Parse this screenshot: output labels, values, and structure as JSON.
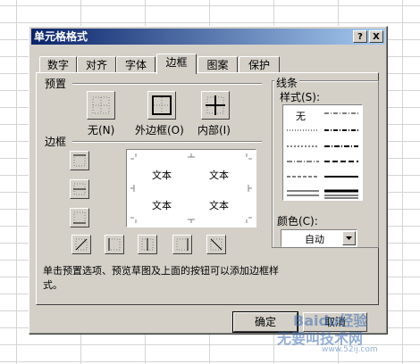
{
  "dialog": {
    "title": "单元格格式",
    "help_label": "?",
    "close_label": "X"
  },
  "tabs": [
    "数字",
    "对齐",
    "字体",
    "边框",
    "图案",
    "保护"
  ],
  "active_tab": "边框",
  "presets": {
    "section_label": "预置",
    "none_label": "无(N)",
    "outline_label": "外边框(O)",
    "inside_label": "内部(I)"
  },
  "border": {
    "section_label": "边框",
    "preview_texts": [
      "文本",
      "文本",
      "文本",
      "文本"
    ]
  },
  "line": {
    "section_label": "线条",
    "style_label": "样式(S):",
    "none_style": "无",
    "color_label": "颜色(C):",
    "color_value": "自动"
  },
  "description": "单击预置选项、预览草图及上面的按钮可以添加边框样式。",
  "buttons": {
    "ok_label": "确定",
    "cancel_label": "取消"
  },
  "watermark": {
    "text1": "Baidu经验",
    "text2": "无要叫技术网",
    "text3": "www.52ij.com"
  },
  "colors": {
    "title_start": "#0a246a",
    "title_end": "#a6caf0",
    "dialog_bg": "#d4d0c8"
  }
}
